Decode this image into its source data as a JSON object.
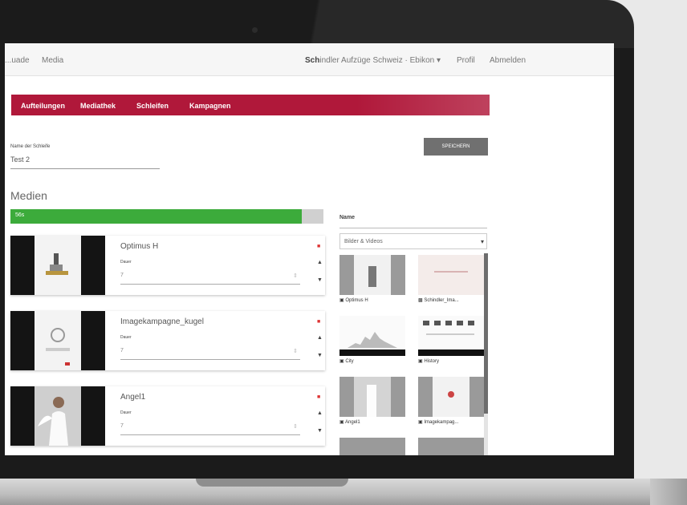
{
  "topnav": {
    "left_items": [
      "...uade",
      "Media"
    ],
    "account_bold": "Sch",
    "account_rest": "indler Aufzüge Schweiz · Ebikon ▾",
    "profile": "Profil",
    "logout": "Abmelden"
  },
  "tabs": [
    "Aufteilungen",
    "Mediathek",
    "Schleifen",
    "Kampagnen"
  ],
  "form": {
    "name_label": "Name der Schleife",
    "name_value": "Test 2",
    "save_label": "SPEICHERN"
  },
  "media": {
    "heading": "Medien",
    "progress_text": "56s",
    "progress_fraction": 0.93,
    "items": [
      {
        "title": "Optimus H",
        "duration_label": "Dauer",
        "duration_value": "7"
      },
      {
        "title": "Imagekampagne_kugel",
        "duration_label": "Dauer",
        "duration_value": "7"
      },
      {
        "title": "Angel1",
        "duration_label": "Dauer",
        "duration_value": "7"
      }
    ]
  },
  "library": {
    "name_label": "Name",
    "filter_value": "Bilder & Videos",
    "items": [
      {
        "caption": "Optimus H",
        "icon": "image-icon"
      },
      {
        "caption": "Schindler_Ima...",
        "icon": "video-icon"
      },
      {
        "caption": "City",
        "icon": "image-icon"
      },
      {
        "caption": "History",
        "icon": "image-icon"
      },
      {
        "caption": "Angel1",
        "icon": "image-icon"
      },
      {
        "caption": "Imagekampag...",
        "icon": "image-icon"
      }
    ]
  },
  "colors": {
    "accent": "#b0183a",
    "progress": "#3cab3b",
    "save": "#707070"
  }
}
